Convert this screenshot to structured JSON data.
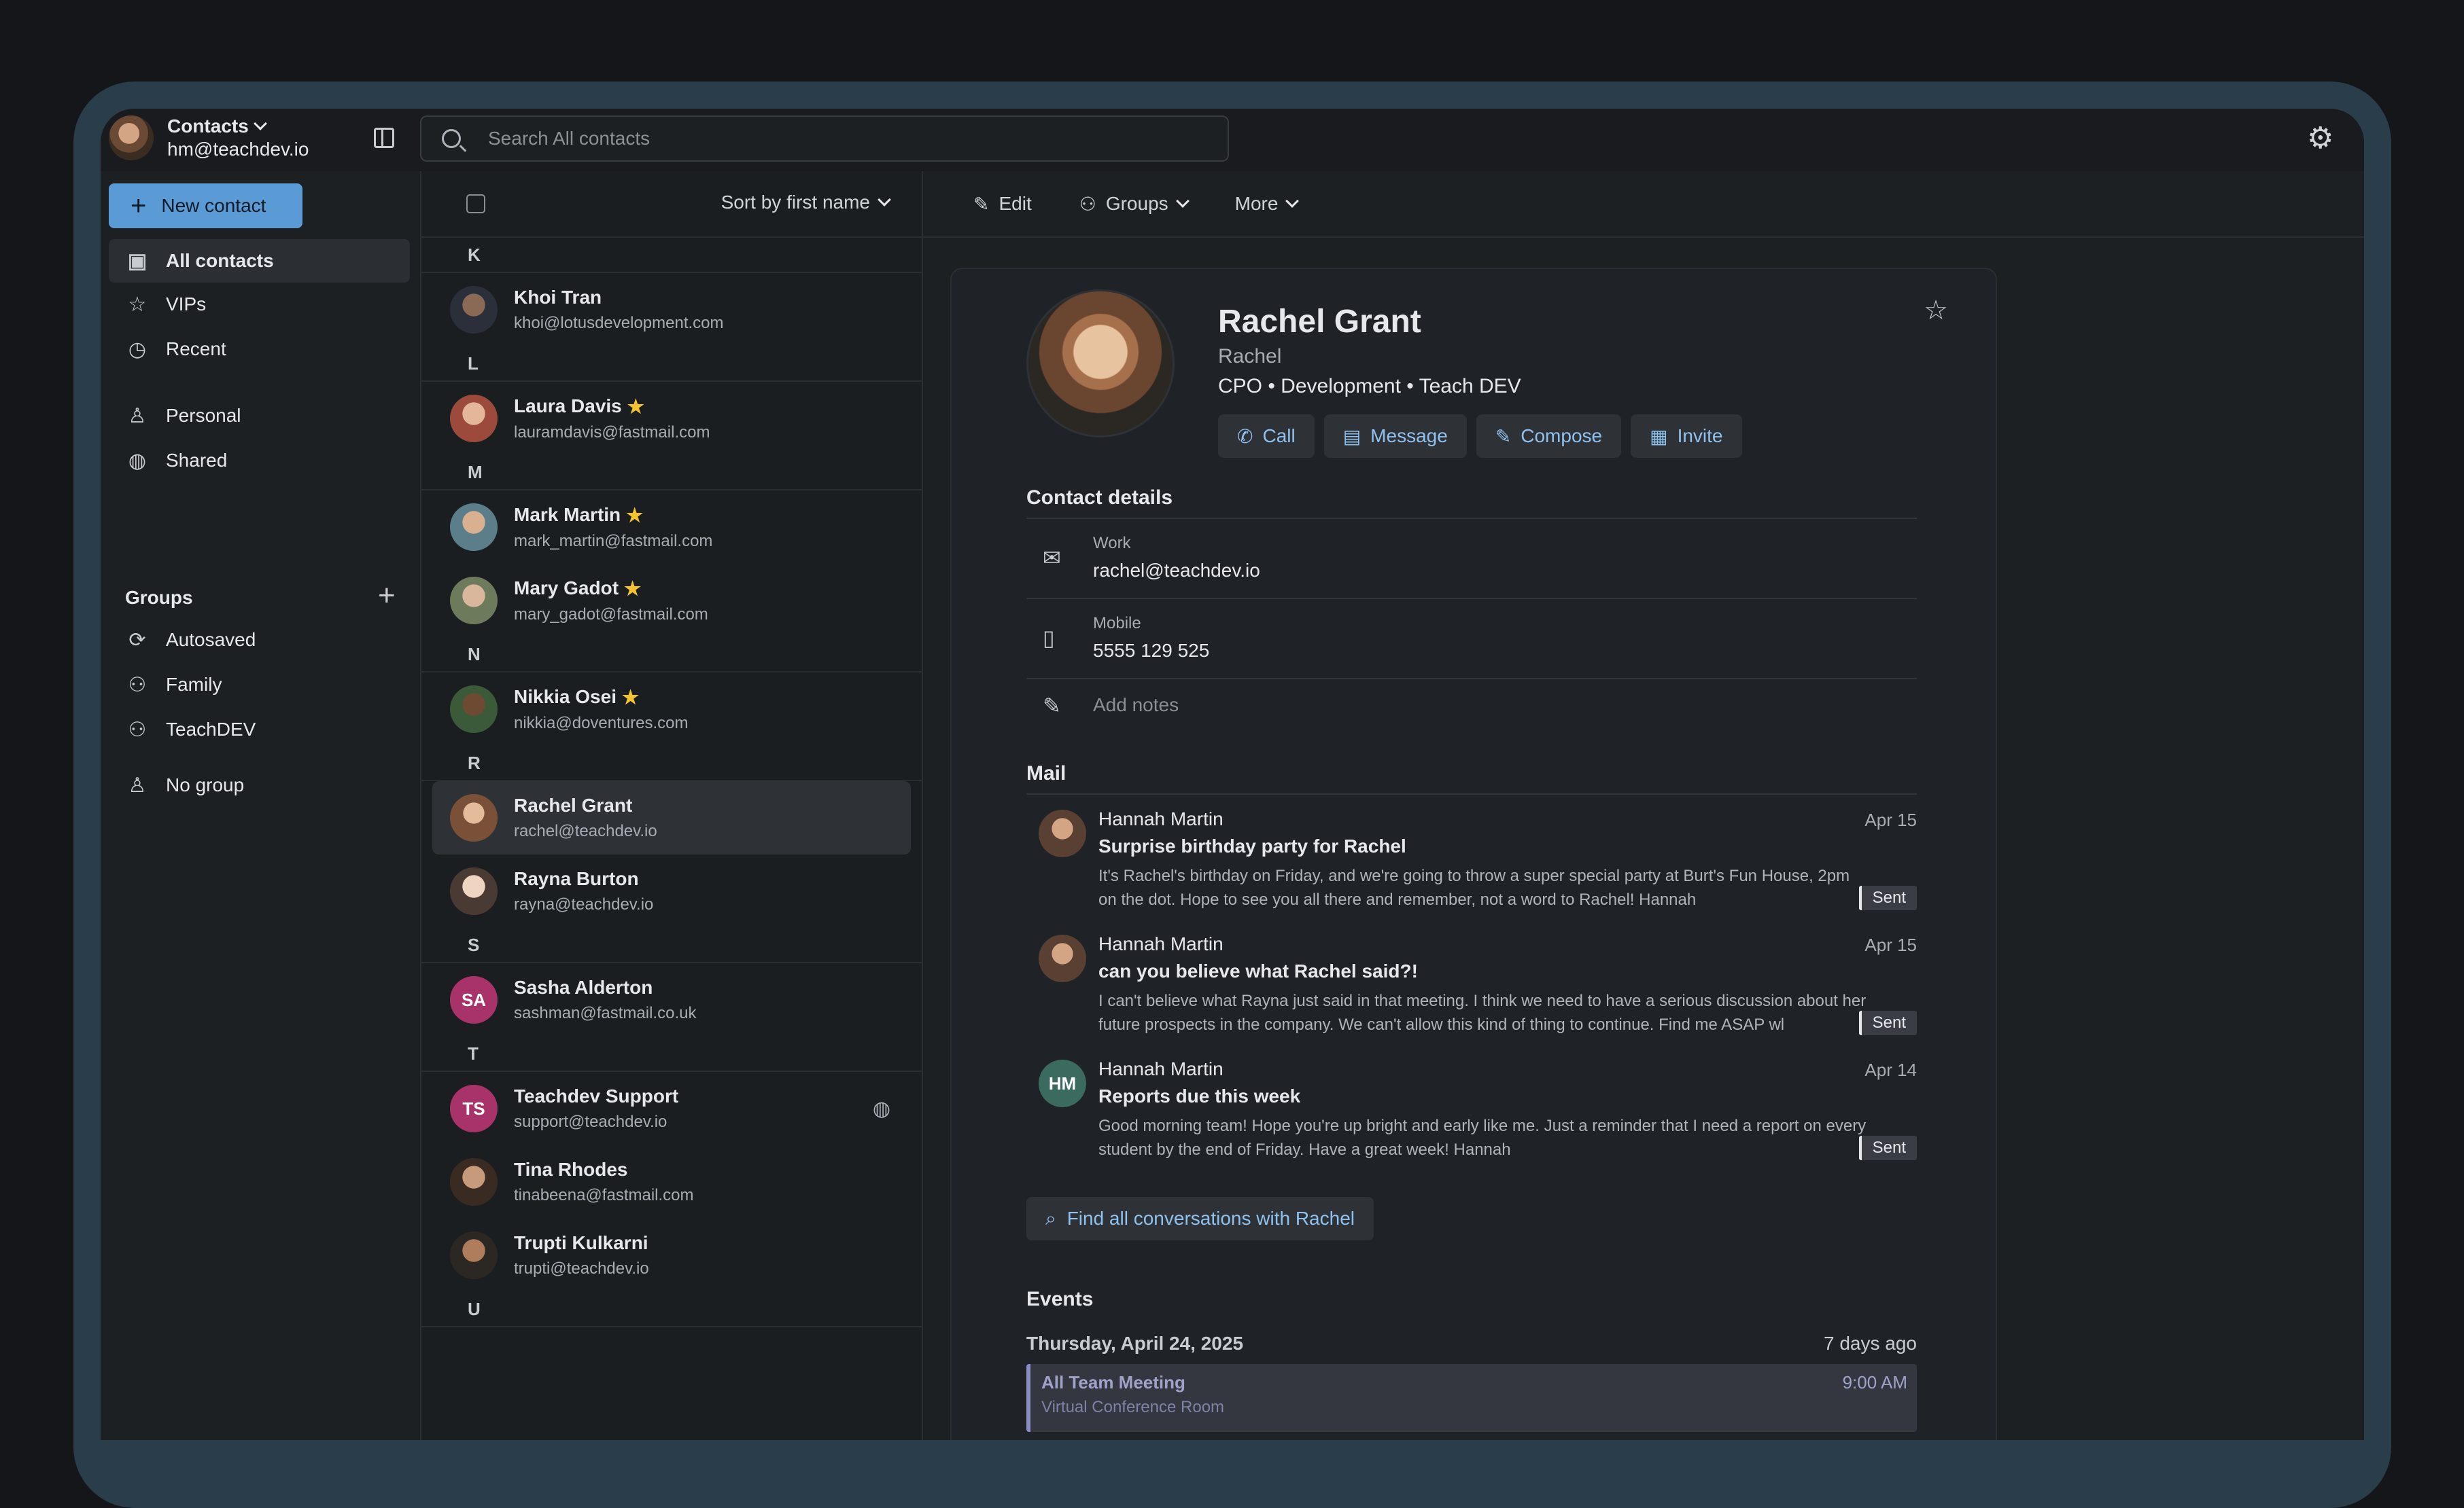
{
  "account": {
    "app": "Contacts",
    "email": "hm@teachdev.io"
  },
  "search": {
    "placeholder": "Search All contacts"
  },
  "nav": {
    "new_contact": "New contact",
    "items": [
      {
        "label": "All contacts",
        "icon": "contacts-book-icon"
      },
      {
        "label": "VIPs",
        "icon": "star-icon"
      },
      {
        "label": "Recent",
        "icon": "clock-icon"
      },
      {
        "label": "Personal",
        "icon": "person-icon"
      },
      {
        "label": "Shared",
        "icon": "globe-icon"
      }
    ],
    "groups_title": "Groups",
    "groups": [
      {
        "label": "Autosaved",
        "icon": "sync-icon"
      },
      {
        "label": "Family",
        "icon": "people-icon"
      },
      {
        "label": "TeachDEV",
        "icon": "people-icon"
      }
    ],
    "no_group": "No group"
  },
  "list": {
    "sort_label": "Sort by first name",
    "letters": [
      "K",
      "L",
      "M",
      "N",
      "R",
      "S",
      "T",
      "U"
    ],
    "contacts": [
      {
        "name": "Khoi Tran",
        "email": "khoi@lotusdevelopment.com"
      },
      {
        "name": "Laura Davis",
        "email": "lauramdavis@fastmail.com"
      },
      {
        "name": "Mark Martin",
        "email": "mark_martin@fastmail.com"
      },
      {
        "name": "Mary Gadot",
        "email": "mary_gadot@fastmail.com"
      },
      {
        "name": "Nikkia Osei",
        "email": "nikkia@doventures.com"
      },
      {
        "name": "Rachel Grant",
        "email": "rachel@teachdev.io"
      },
      {
        "name": "Rayna Burton",
        "email": "rayna@teachdev.io"
      },
      {
        "name": "Sasha Alderton",
        "email": "sashman@fastmail.co.uk",
        "initials": "SA"
      },
      {
        "name": "Teachdev Support",
        "email": "support@teachdev.io",
        "initials": "TS"
      },
      {
        "name": "Tina Rhodes",
        "email": "tinabeena@fastmail.com"
      },
      {
        "name": "Trupti Kulkarni",
        "email": "trupti@teachdev.io"
      }
    ]
  },
  "toolbar": {
    "edit": "Edit",
    "groups": "Groups",
    "more": "More"
  },
  "profile": {
    "name": "Rachel Grant",
    "nickname": "Rachel",
    "role": "CPO • Development • Teach DEV",
    "actions": {
      "call": "Call",
      "message": "Message",
      "compose": "Compose",
      "invite": "Invite"
    }
  },
  "details": {
    "title": "Contact details",
    "work_label": "Work",
    "work_value": "rachel@teachdev.io",
    "mobile_label": "Mobile",
    "mobile_value": "5555 129 525",
    "notes_placeholder": "Add notes"
  },
  "mail": {
    "title": "Mail",
    "items": [
      {
        "from": "Hannah Martin",
        "date": "Apr 15",
        "subject": "Surprise birthday party for Rachel",
        "body": "It's Rachel's birthday on Friday, and we're going to throw a super special party at Burt's Fun House, 2pm on the dot. Hope to see you all there and remember, not a word to Rachel! Hannah",
        "status": "Sent"
      },
      {
        "from": "Hannah Martin",
        "date": "Apr 15",
        "subject": "can you believe what Rachel said?!",
        "body": "I can't believe what Rayna just said in that meeting. I think we need to have a serious discussion about her future prospects in the company. We can't allow this kind of thing to continue. Find me ASAP wl",
        "status": "Sent"
      },
      {
        "from": "Hannah Martin",
        "date": "Apr 14",
        "subject": "Reports due this week",
        "body": "Good morning team! Hope you're up bright and early like me. Just a reminder that I need a report on every student by the end of Friday. Have a great week! Hannah",
        "status": "Sent",
        "initials": "HM"
      }
    ],
    "find_all": "Find all conversations with Rachel"
  },
  "events": {
    "title": "Events",
    "date": "Thursday, April 24, 2025",
    "ago": "7 days ago",
    "item": {
      "title": "All Team Meeting",
      "time": "9:00 AM",
      "location": "Virtual Conference Room"
    }
  }
}
